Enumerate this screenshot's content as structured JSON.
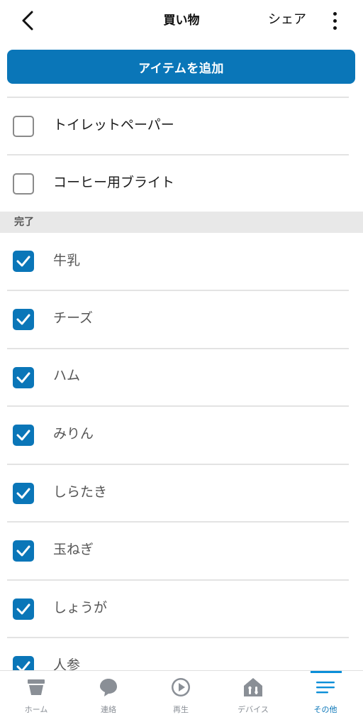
{
  "header": {
    "title": "買い物",
    "share_label": "シェア",
    "back_icon": "chevron-left-icon",
    "more_icon": "kebab-menu-icon"
  },
  "add_button": {
    "label": "アイテムを追加"
  },
  "open_items": [
    {
      "label": "トイレットペーパー",
      "checked": false
    },
    {
      "label": "コーヒー用ブライト",
      "checked": false
    }
  ],
  "completed_section": {
    "label": "完了"
  },
  "completed_items": [
    {
      "label": "牛乳",
      "checked": true
    },
    {
      "label": "チーズ",
      "checked": true
    },
    {
      "label": "ハム",
      "checked": true
    },
    {
      "label": "みりん",
      "checked": true
    },
    {
      "label": "しらたき",
      "checked": true
    },
    {
      "label": "玉ねぎ",
      "checked": true
    },
    {
      "label": "しょうが",
      "checked": true
    },
    {
      "label": "人参",
      "checked": true
    }
  ],
  "bottom_nav": {
    "items": [
      {
        "label": "ホーム",
        "icon": "home-icon",
        "active": false
      },
      {
        "label": "連絡",
        "icon": "chat-bubble-icon",
        "active": false
      },
      {
        "label": "再生",
        "icon": "play-icon",
        "active": false
      },
      {
        "label": "デバイス",
        "icon": "devices-icon",
        "active": false
      },
      {
        "label": "その他",
        "icon": "menu-icon",
        "active": true
      }
    ]
  },
  "colors": {
    "accent": "#0a76b8",
    "checkbox_off_border": "#8a8a8a",
    "section_bg": "#e8e8e8",
    "nav_inactive": "#8a8f96"
  }
}
